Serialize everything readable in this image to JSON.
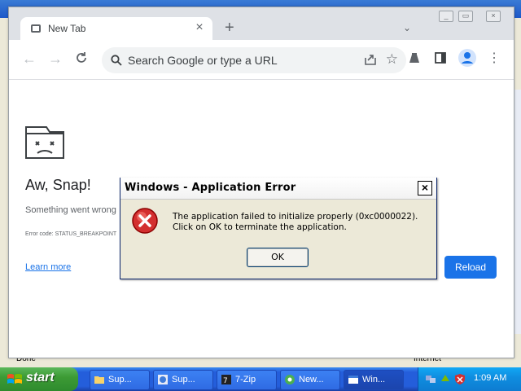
{
  "background_window": {
    "status_done": "Done",
    "status_zone": "Internet"
  },
  "chrome": {
    "tab_title": "New Tab",
    "omnibox_placeholder": "Search Google or type a URL",
    "crash_title": "Aw, Snap!",
    "crash_message": "Something went wrong",
    "error_code": "Error code: STATUS_BREAKPOINT",
    "learn_more": "Learn more",
    "reload_label": "Reload"
  },
  "dialog": {
    "title": "Windows - Application Error",
    "message": "The application failed to initialize properly (0xc0000022). Click on OK to terminate the application.",
    "ok_label": "OK"
  },
  "taskbar": {
    "start_label": "start",
    "tasks": [
      {
        "label": "Sup..."
      },
      {
        "label": "Sup..."
      },
      {
        "label": "7-Zip"
      },
      {
        "label": "New..."
      },
      {
        "label": "Win..."
      }
    ],
    "clock": "1:09 AM"
  },
  "colors": {
    "accent_blue": "#1a73e8",
    "xp_taskbar": "#245edb",
    "xp_start": "#3d9b35",
    "error_red": "#d32f2f"
  }
}
